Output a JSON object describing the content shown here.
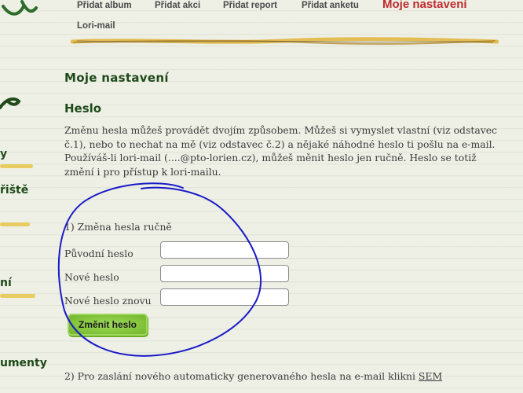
{
  "sidebar": {
    "fragments": [
      {
        "label": "y"
      },
      {
        "label": "řiště"
      },
      {
        "label": "ní"
      },
      {
        "label": "umenty"
      }
    ]
  },
  "nav": {
    "items": [
      {
        "label": "Přidat album"
      },
      {
        "label": "Přidat akci"
      },
      {
        "label": "Přidat report"
      },
      {
        "label": "Přidat anketu"
      },
      {
        "label": "Moje nastavení"
      },
      {
        "label": "Lori-mail"
      }
    ]
  },
  "page": {
    "title": "Moje nastavení"
  },
  "password": {
    "title": "Heslo",
    "intro": "Změnu hesla můžeš provádět dvojím způsobem. Můžeš si vymyslet vlastní (viz odstavec č.1), nebo to nechat na mě (viz odstavec č.2) a nějaké náhodné heslo ti pošlu na e-mail. Používáš-li lori-mail (....@pto-lorien.cz), můžeš měnit heslo jen ručně. Heslo se totiž změní i pro přístup k lori-mailu.",
    "manual": {
      "heading": "1) Změna hesla ručně",
      "fields": [
        {
          "label": "Původní heslo",
          "value": ""
        },
        {
          "label": "Nové heslo",
          "value": ""
        },
        {
          "label": "Nové heslo znovu",
          "value": ""
        }
      ],
      "submit_label": "Změnit heslo"
    },
    "auto": {
      "text": "2) Pro zaslání nového automaticky generovaného hesla na e-mail klikni ",
      "link_label": "SEM"
    }
  },
  "colors": {
    "accent_active": "#c0292d",
    "heading_green": "#1f4a1a",
    "annotation_blue": "#1a1ac8",
    "button_green": "#87c83f"
  }
}
